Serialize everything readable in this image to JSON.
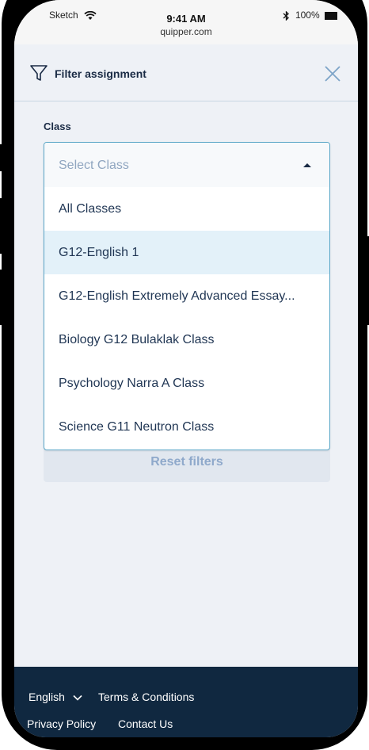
{
  "status_bar": {
    "carrier": "Sketch",
    "time": "9:41 AM",
    "url": "quipper.com",
    "battery": "100%"
  },
  "header": {
    "title": "Filter assignment"
  },
  "filter": {
    "class_label": "Class",
    "dropdown_placeholder": "Select Class",
    "options": [
      "All Classes",
      "G12-English 1",
      "G12-English Extremely Advanced Essay...",
      "Biology G12 Bulaklak Class",
      "Psychology Narra A Class",
      "Science G11 Neutron Class"
    ],
    "highlighted_option": "G12-English 1",
    "reset_label": "Reset filters"
  },
  "footer": {
    "language": "English",
    "terms": "Terms & Conditions",
    "privacy": "Privacy Policy",
    "contact": "Contact Us"
  },
  "colors": {
    "footer_bg": "#102840",
    "dropdown_border": "#5aa6c7",
    "highlight_bg": "#e3f1f9",
    "text_primary": "#1f3553"
  },
  "icons": [
    "wifi-icon",
    "bluetooth-icon",
    "battery-icon",
    "filter-icon",
    "close-icon",
    "caret-up-icon",
    "chevron-down-icon"
  ]
}
